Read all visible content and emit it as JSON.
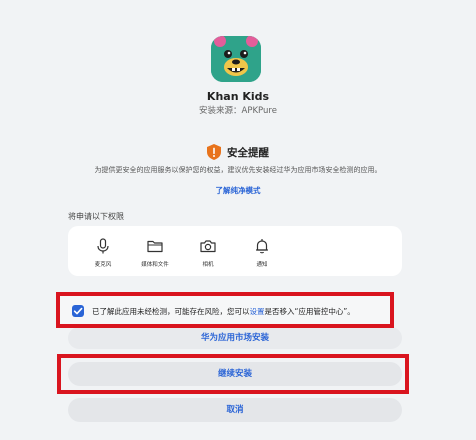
{
  "app": {
    "name": "Khan Kids",
    "source_label": "安装来源：",
    "source_value": "APKPure",
    "icon": "khan-kids-bear-icon"
  },
  "warning": {
    "icon": "shield-warning-icon",
    "title": "安全提醒",
    "text": "为提供更安全的应用服务以保护您的权益，建议优先安装经过华为应用市场安全检测的应用。",
    "link": "了解纯净模式"
  },
  "permissions": {
    "heading": "将申请以下权限",
    "items": [
      {
        "label": "麦克风",
        "icon": "microphone-icon"
      },
      {
        "label": "媒体和文件",
        "icon": "folder-icon"
      },
      {
        "label": "相机",
        "icon": "camera-icon"
      },
      {
        "label": "通知",
        "icon": "bell-icon"
      }
    ]
  },
  "consent": {
    "checked": true,
    "text_before": "已了解此应用未经检测，可能存在风险，您可以",
    "link": "设置",
    "text_after": "是否移入“应用管控中心”。"
  },
  "buttons": {
    "store_install": "华为应用市场安装",
    "continue_install": "继续安装",
    "cancel": "取消"
  },
  "colors": {
    "accent": "#2a64d6",
    "highlight": "#d9141e",
    "warning": "#e8731c",
    "icon_green": "#2fa38a"
  }
}
